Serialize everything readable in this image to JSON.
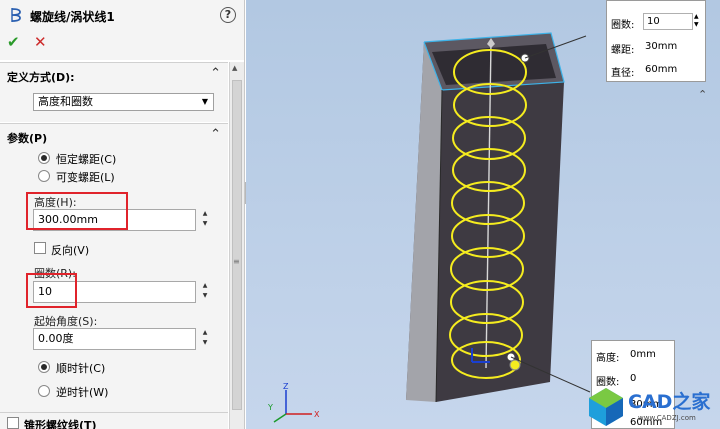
{
  "panel": {
    "title": "螺旋线/涡状线1",
    "help_icon": "?",
    "ok_icon": "✔",
    "cancel_icon": "✕"
  },
  "definition_section": {
    "title": "定义方式(D):",
    "selected_option": "高度和圈数"
  },
  "parameters_section": {
    "title": "参数(P)",
    "radio_constant_pitch": "恒定螺距(C)",
    "radio_variable_pitch": "可变螺距(L)",
    "height_label": "高度(H):",
    "height_value": "300.00mm",
    "reverse_label": "反向(V)",
    "revolutions_label": "圈数(R):",
    "revolutions_value": "10",
    "start_angle_label": "起始角度(S):",
    "start_angle_value": "0.00度",
    "radio_clockwise": "顺时针(C)",
    "radio_counterclockwise": "逆时针(W)"
  },
  "taper_section": {
    "title": "锥形螺纹线(T)"
  },
  "callout_top": {
    "rev_label": "圈数:",
    "rev_value": "10",
    "pitch_label": "螺距:",
    "pitch_value": "30mm",
    "diameter_label": "直径:",
    "diameter_value": "60mm"
  },
  "callout_bottom": {
    "height_label": "高度:",
    "height_value": "0mm",
    "rev_label": "圈数:",
    "rev_value": "0",
    "pitch_value": "30mm",
    "diameter_value": "60mm"
  },
  "watermark": {
    "title": "CAD之家",
    "url": "www.CADZJ.com"
  },
  "colors": {
    "helix": "#f5ec1f",
    "highlight_box": "#e0232b",
    "viewport_bg": "#b8cce4",
    "body_dark": "#3e3a42",
    "body_light": "#9fa0a6",
    "edge": "#3db2e8"
  },
  "axis_labels": {
    "x": "X",
    "y": "Y",
    "z": "Z"
  }
}
